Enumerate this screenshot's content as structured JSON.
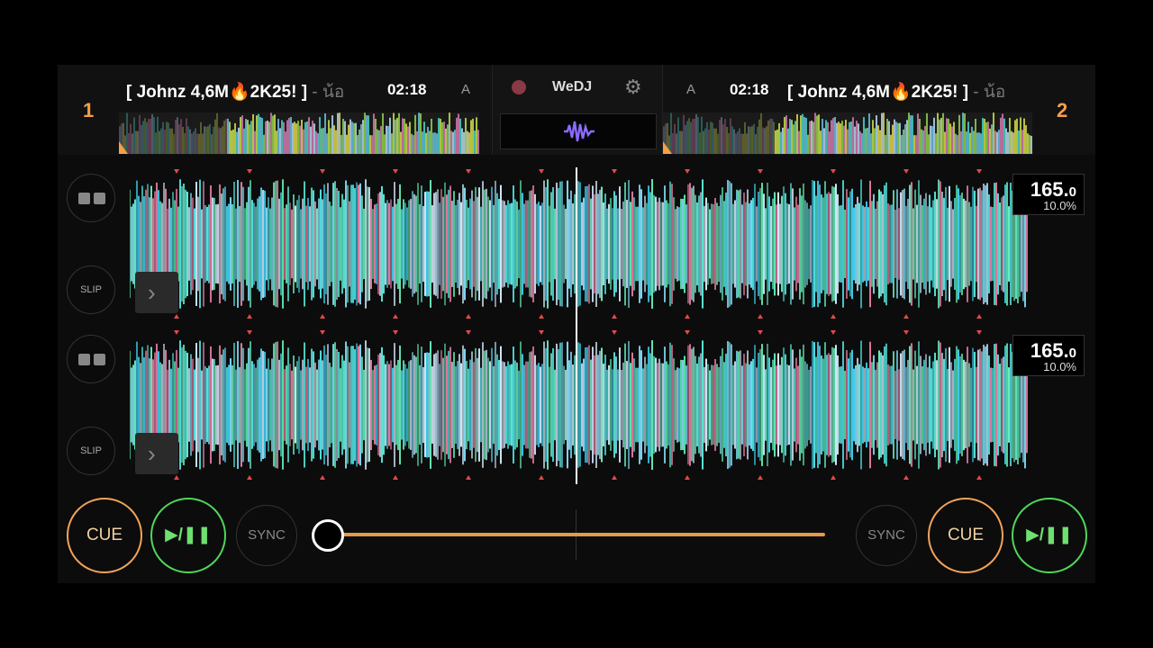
{
  "app": {
    "name": "WeDJ"
  },
  "colors": {
    "accent_cue": "#f0a35a",
    "accent_play": "#4fd65a",
    "crossfader": "#e49a4e",
    "waveform": "#4fe0e0"
  },
  "deck1": {
    "number": "1",
    "title": "[ Johnz 4,6M🔥2K25! ]",
    "title_tail": " - น้อ",
    "time": "02:18",
    "mode": "A",
    "bpm_int": "165.",
    "bpm_dec": "0",
    "pitch": "10.0%",
    "slip_label": "SLIP",
    "cue_label": "CUE",
    "play_label": "▶/❚❚",
    "sync_label": "SYNC"
  },
  "deck2": {
    "number": "2",
    "title": "[ Johnz 4,6M🔥2K25! ]",
    "title_tail": " - น้อ",
    "time": "02:18",
    "mode": "A",
    "bpm_int": "165.",
    "bpm_dec": "0",
    "pitch": "10.0%",
    "slip_label": "SLIP",
    "cue_label": "CUE",
    "play_label": "▶/❚❚",
    "sync_label": "SYNC"
  },
  "crossfader": {
    "position": 0.0
  },
  "icons": {
    "record": "record-icon",
    "settings": "gear-icon",
    "waveform": "waveform-icon",
    "next": "chevron-right-icon",
    "loop": "loop-icon"
  }
}
